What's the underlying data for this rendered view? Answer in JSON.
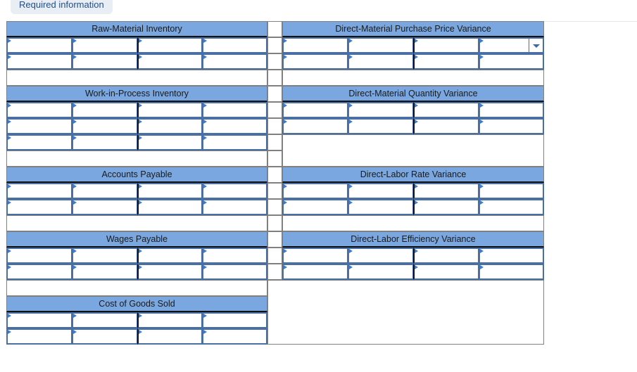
{
  "badge": {
    "label": "Required information"
  },
  "accounts": {
    "left": [
      {
        "title": "Raw-Material Inventory",
        "rows": 2
      },
      {
        "title": "Work-in-Process Inventory",
        "rows": 3
      },
      {
        "title": "Accounts Payable",
        "rows": 2
      },
      {
        "title": "Wages Payable",
        "rows": 2
      },
      {
        "title": "Cost of Goods Sold",
        "rows": 2
      }
    ],
    "right": [
      {
        "title": "Direct-Material Purchase Price Variance",
        "rows": 2,
        "dropdown_first_row_last_cell": true
      },
      {
        "title": "Direct-Material Quantity Variance",
        "rows": 2
      },
      {
        "title": "Direct-Labor Rate Variance",
        "rows": 2
      },
      {
        "title": "Direct-Labor Efficiency Variance",
        "rows": 2
      }
    ]
  }
}
